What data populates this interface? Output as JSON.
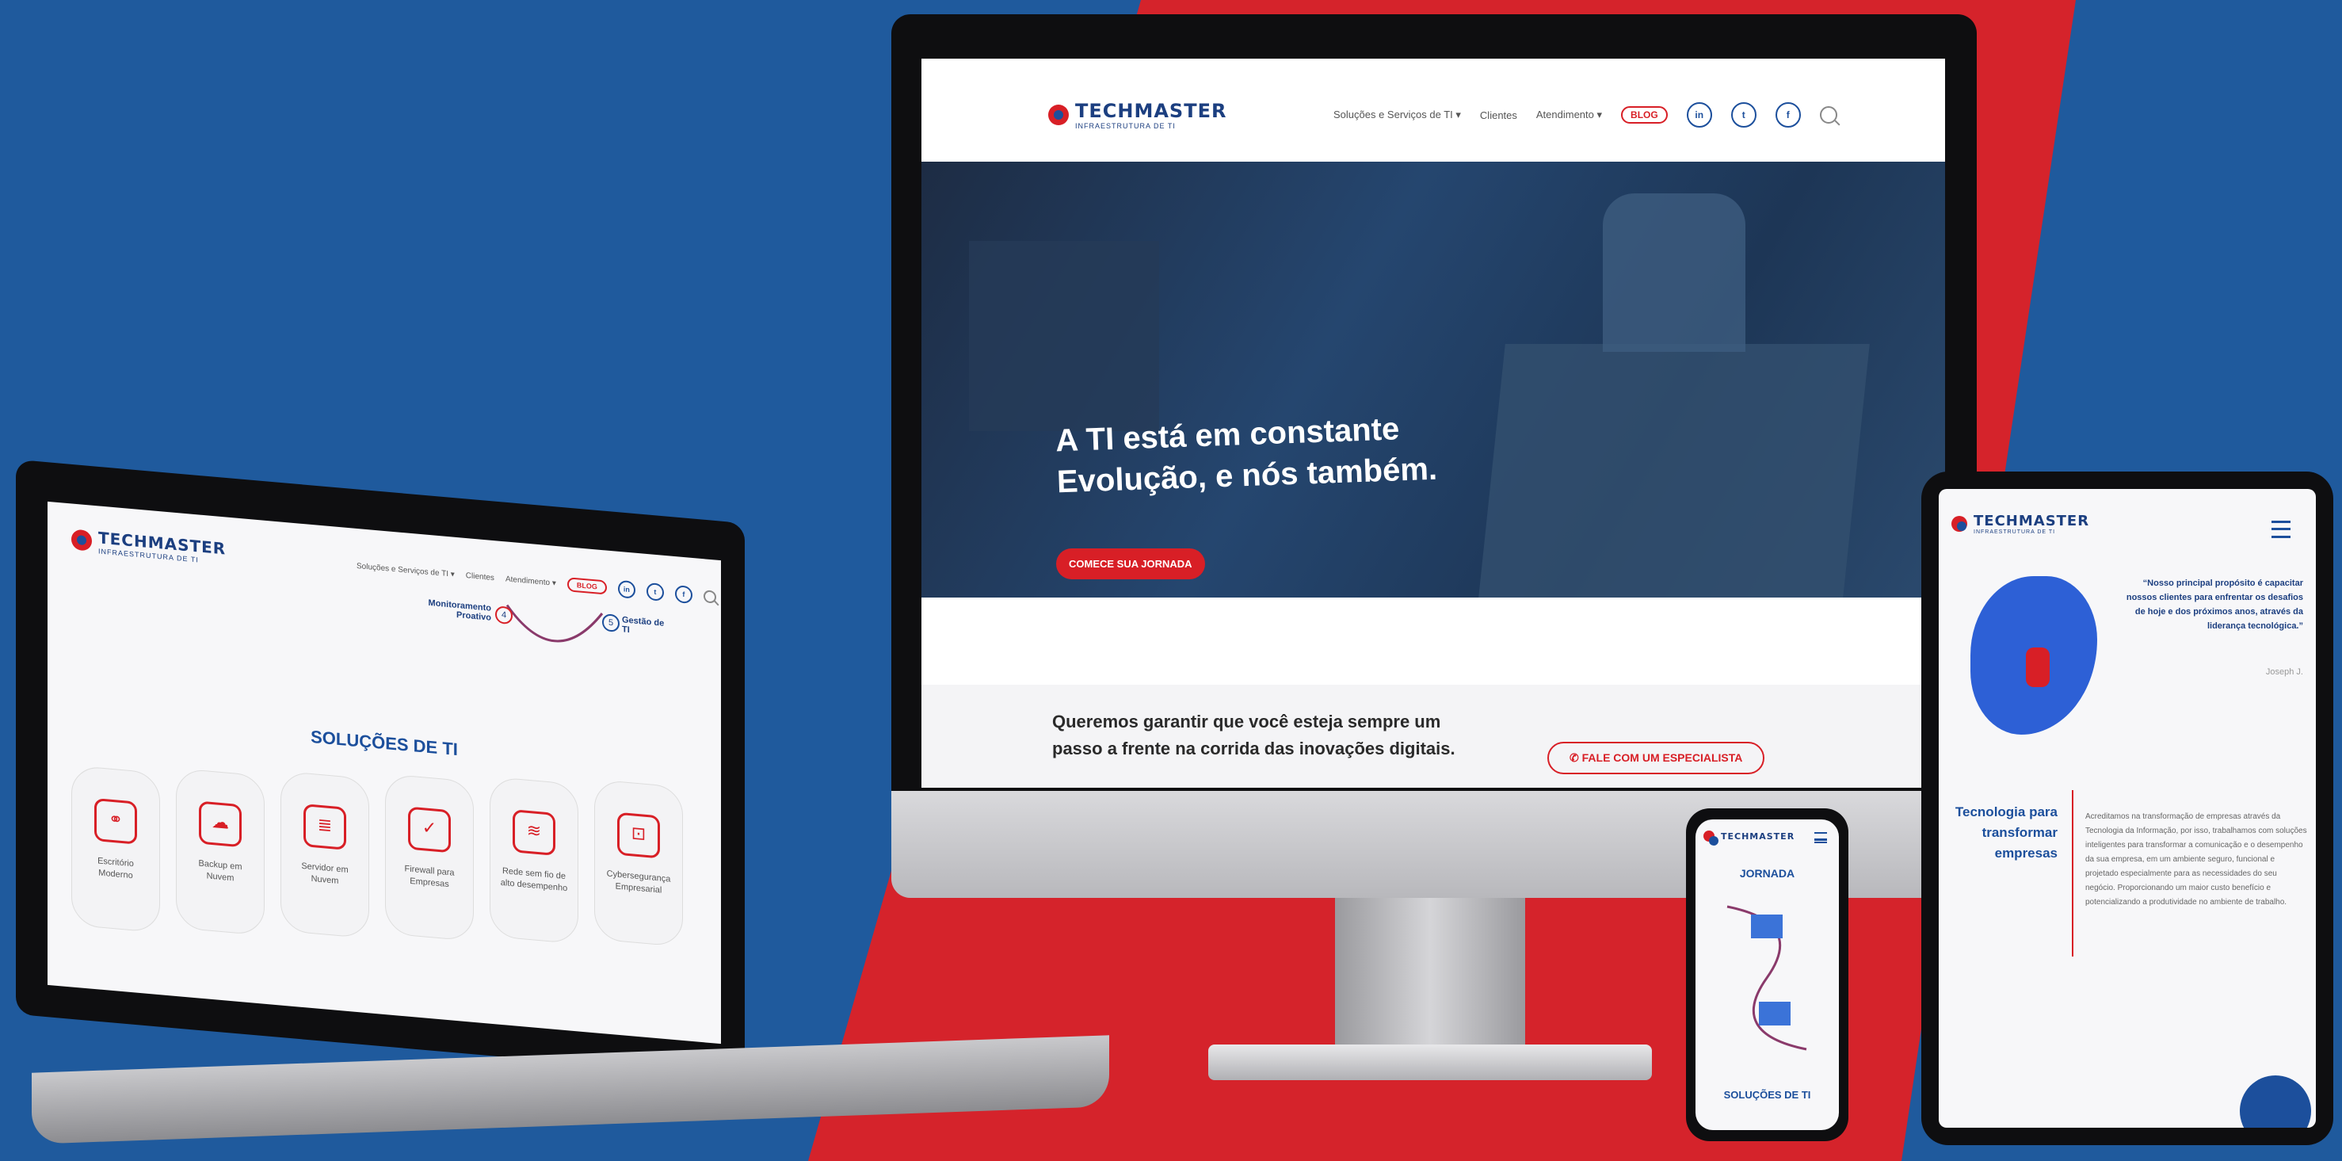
{
  "brand": {
    "name": "TECHMASTER",
    "tagline": "INFRAESTRUTURA DE TI"
  },
  "nav": {
    "solutions": "Soluções e Serviços de TI ▾",
    "clients": "Clientes",
    "support": "Atendimento ▾",
    "blog": "BLOG",
    "social": [
      "in",
      "t",
      "f"
    ]
  },
  "monitor": {
    "hero_title_line1": "A TI está em constante",
    "hero_title_line2": "Evolução, e nós também.",
    "cta": "COMECE SUA JORNADA",
    "bottom_text_line1": "Queremos garantir que você esteja sempre um",
    "bottom_text_line2": "passo a frente na corrida das inovações digitais.",
    "specialist_button": "FALE COM UM ESPECIALISTA"
  },
  "laptop": {
    "step4": "Monitoramento Proativo",
    "step4_num": "4",
    "step5": "Gestão de TI",
    "step5_num": "5",
    "section_title": "SOLUÇÕES DE TI",
    "solutions": [
      "Escritório Moderno",
      "Backup em Nuvem",
      "Servidor em Nuvem",
      "Firewall para Empresas",
      "Rede sem fio de alto desempenho",
      "Cybersegurança Empresarial"
    ]
  },
  "tablet": {
    "quote": "“Nosso principal propósito é capacitar nossos clientes para enfrentar os desafios de hoje e dos próximos anos, através da liderança tecnológica.”",
    "quote_author": "Joseph J.",
    "heading": "Tecnologia para transformar empresas",
    "body": "Acreditamos na transformação de empresas através da Tecnologia da Informação, por isso, trabalhamos com soluções inteligentes para transformar a comunicação e o desempenho da sua empresa, em um ambiente seguro, funcional e projetado especialmente para as necessidades do seu negócio. Proporcionando um maior custo benefício e potencializando a produtividade no ambiente de trabalho."
  },
  "phone": {
    "title": "JORNADA",
    "section": "SOLUÇÕES DE TI"
  },
  "colors": {
    "brand_red": "#d81f26",
    "brand_blue": "#1c4f9c",
    "bg_blue": "#1f5a9d"
  }
}
